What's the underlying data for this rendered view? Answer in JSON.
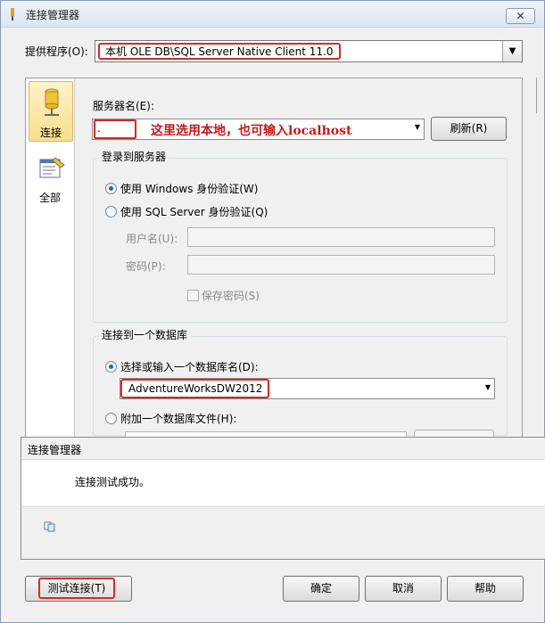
{
  "window": {
    "title": "连接管理器",
    "close_label": "✕"
  },
  "provider": {
    "label": "提供程序(O):",
    "value": "本机 OLE DB\\SQL Server Native Client 11.0"
  },
  "nav": {
    "items": [
      {
        "label": "连接",
        "icon": "database-icon"
      },
      {
        "label": "全部",
        "icon": "properties-icon"
      }
    ]
  },
  "server": {
    "label": "服务器名(E):",
    "value": ".",
    "annotation": "这里选用本地，也可输入localhost",
    "refresh_label": "刷新(R)"
  },
  "login": {
    "group_title": "登录到服务器",
    "windows_auth": "使用 Windows 身份验证(W)",
    "sql_auth": "使用 SQL Server 身份验证(Q)",
    "user_label": "用户名(U):",
    "password_label": "密码(P):",
    "save_password": "保存密码(S)",
    "selected": "windows"
  },
  "database": {
    "group_title": "连接到一个数据库",
    "select_label": "选择或输入一个数据库名(D):",
    "db_name": "AdventureWorksDW2012",
    "attach_label": "附加一个数据库文件(H):"
  },
  "message": {
    "title": "连接管理器",
    "text": "连接测试成功。"
  },
  "buttons": {
    "test": "测试连接(T)",
    "ok": "确定",
    "cancel": "取消",
    "help": "帮助"
  },
  "colors": {
    "highlight": "#d42a2a",
    "annotation": "#c41a1a"
  }
}
